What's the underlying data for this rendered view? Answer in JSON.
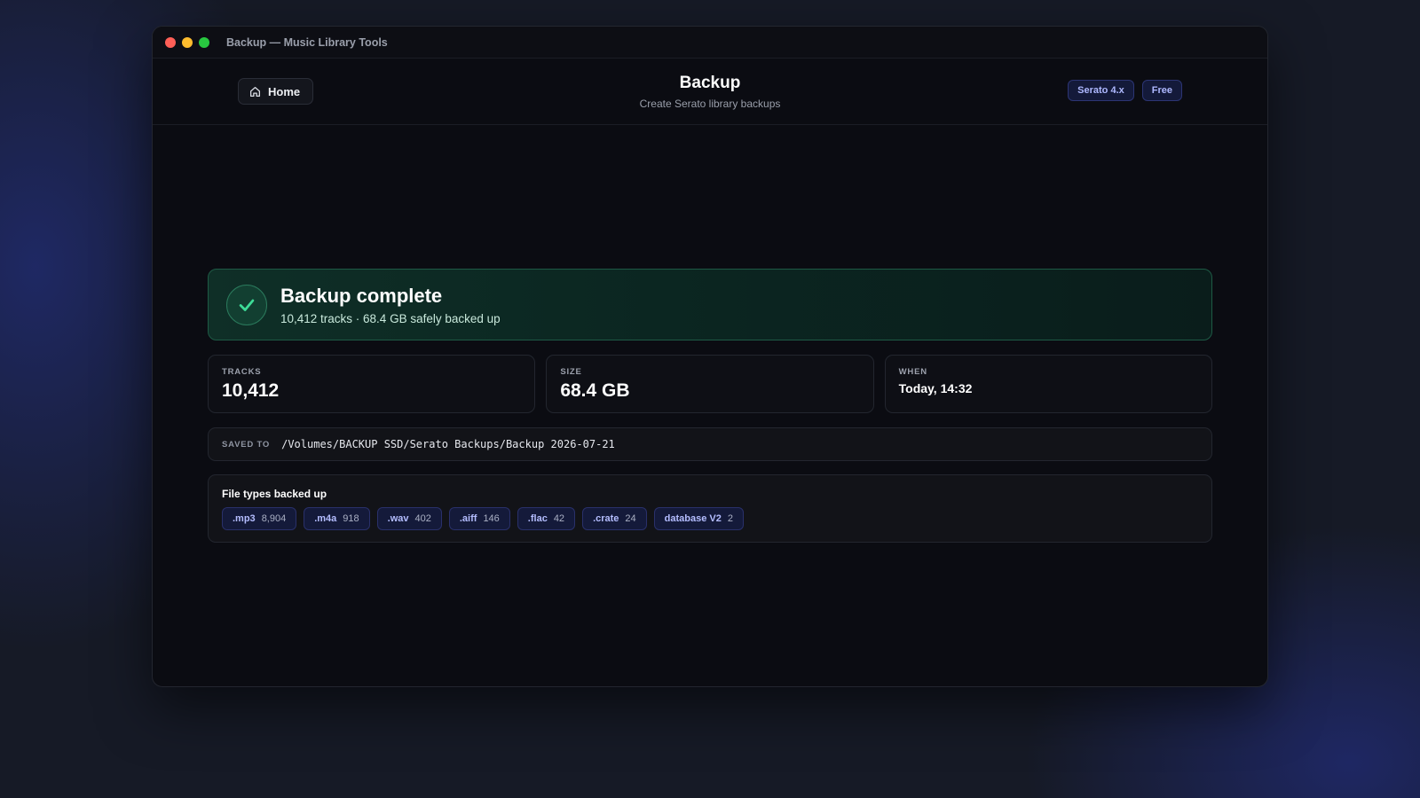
{
  "window": {
    "title": "Backup — Music Library Tools"
  },
  "header": {
    "home_label": "Home",
    "title": "Backup",
    "subtitle": "Create Serato library backups",
    "badges": [
      "Serato 4.x",
      "Free"
    ]
  },
  "result": {
    "title": "Backup complete",
    "summary": "10,412 tracks · 68.4 GB safely backed up",
    "status_color": "#2fbf7f"
  },
  "stats": {
    "tracks": {
      "label": "TRACKS",
      "value": "10,412"
    },
    "size": {
      "label": "SIZE",
      "value": "68.4 GB"
    },
    "when": {
      "label": "WHEN",
      "value": "Today, 14:32"
    }
  },
  "saved_to": {
    "label": "SAVED TO",
    "path": "/Volumes/BACKUP SSD/Serato Backups/Backup 2026-07-21"
  },
  "file_types": {
    "title": "File types backed up",
    "items": [
      {
        "ext": ".mp3",
        "count": "8,904"
      },
      {
        "ext": ".m4a",
        "count": "918"
      },
      {
        "ext": ".wav",
        "count": "402"
      },
      {
        "ext": ".aiff",
        "count": "146"
      },
      {
        "ext": ".flac",
        "count": "42"
      },
      {
        "ext": ".crate",
        "count": "24"
      },
      {
        "ext": "database V2",
        "count": "2"
      }
    ]
  },
  "icons": {
    "home": "home-icon",
    "success": "check-icon"
  },
  "colors": {
    "accent": "#aeb8ff",
    "success": "#2fbf7f",
    "background": "#0b0c12"
  }
}
